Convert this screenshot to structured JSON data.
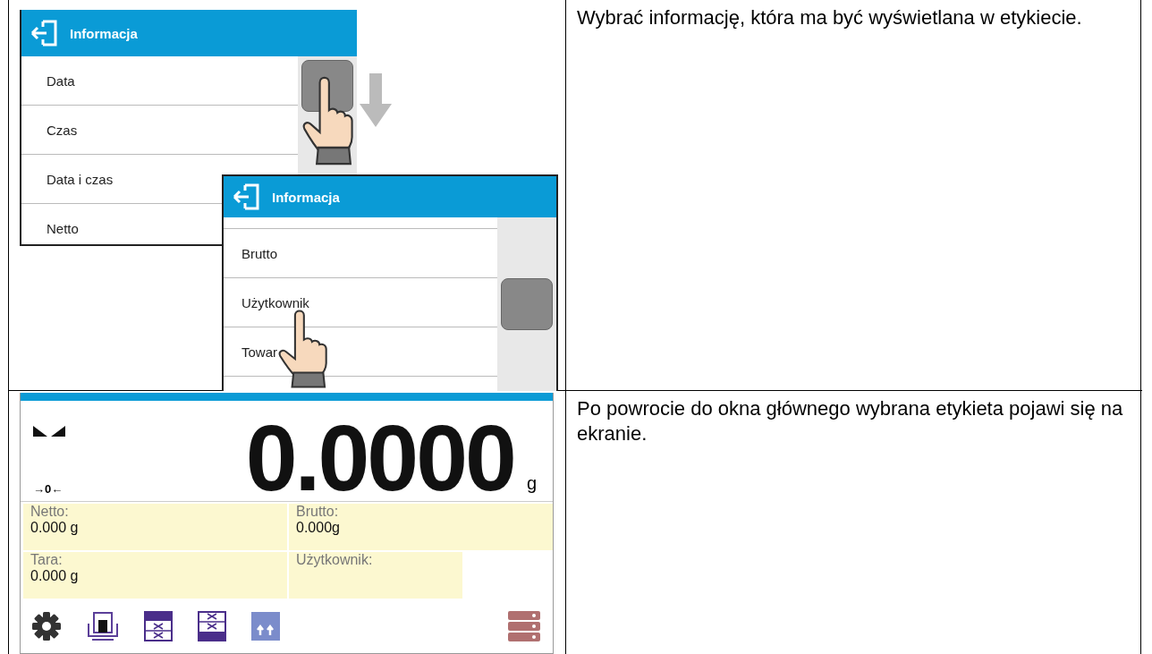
{
  "steps": [
    {
      "kind": "menus",
      "menus": [
        {
          "title": "Informacja",
          "items": [
            "Data",
            "Czas",
            "Data i czas",
            "Netto"
          ]
        },
        {
          "title": "Informacja",
          "items": [
            "Brutto",
            "Użytkownik",
            "Towar"
          ]
        }
      ],
      "instruction": "Wybrać informację, która ma być wyświetlana w etykiecie."
    },
    {
      "kind": "display",
      "reading": "0.0000",
      "unit": "g",
      "zero_indicator": "→0←",
      "fields": [
        {
          "label": "Netto:",
          "value": "0.000 g"
        },
        {
          "label": "Brutto:",
          "value": "0.000g"
        },
        {
          "label": "Tara:",
          "value": "0.000 g"
        },
        {
          "label": "Użytkownik:"
        }
      ],
      "instruction": "Po powrocie do okna głównego wybrana etykieta pojawi się na ekranie."
    }
  ]
}
